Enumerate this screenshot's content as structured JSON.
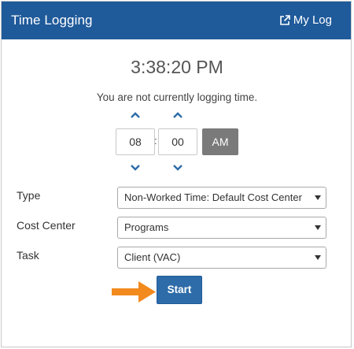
{
  "header": {
    "title": "Time Logging",
    "mylog_label": "My Log",
    "mylog_icon": "external-link-icon",
    "color": "#1f5a9a"
  },
  "clock": {
    "time": "3:38:20 PM"
  },
  "status": {
    "message": "You are not currently logging time."
  },
  "time_input": {
    "hour": "08",
    "separator": ":",
    "minute": "00",
    "ampm": "AM",
    "up_icon": "chevron-up-icon",
    "down_icon": "chevron-down-icon"
  },
  "fields": [
    {
      "label": "Type",
      "value": "Non-Worked Time: Default Cost Center"
    },
    {
      "label": "Cost Center",
      "value": "Programs"
    },
    {
      "label": "Task",
      "value": "Client (VAC)"
    }
  ],
  "actions": {
    "start_label": "Start",
    "start_color": "#2d6ca8",
    "pointer_arrow_color": "#f28a1e"
  }
}
